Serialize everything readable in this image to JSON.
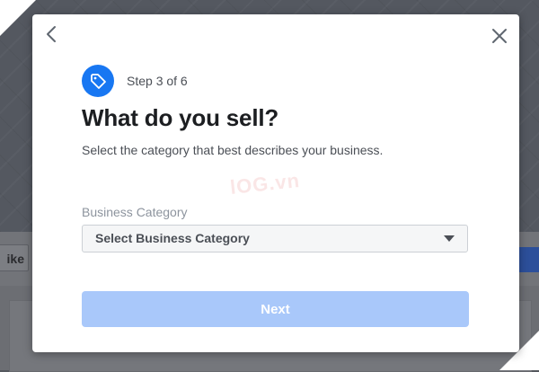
{
  "background": {
    "like_button_label": "ike",
    "overlay_color": "#55585e"
  },
  "modal": {
    "back_icon": "chevron-left-icon",
    "close_icon": "close-icon",
    "step_icon": "tag-icon",
    "step_label": "Step 3 of 6",
    "title": "What do you sell?",
    "subtitle": "Select the category that best describes your business.",
    "watermark_text": "lOG.vn",
    "field": {
      "label": "Business Category",
      "selected_value": "Select Business Category",
      "caret_icon": "caret-down-icon"
    },
    "next_button_label": "Next"
  },
  "colors": {
    "accent": "#1877f2",
    "next_button_disabled": "#a9c8fa",
    "title_text": "#1c1e21",
    "secondary_text": "#4b4f56",
    "label_text": "#8d949e",
    "select_background": "#f5f6f7",
    "select_border": "#ccd0d5"
  }
}
